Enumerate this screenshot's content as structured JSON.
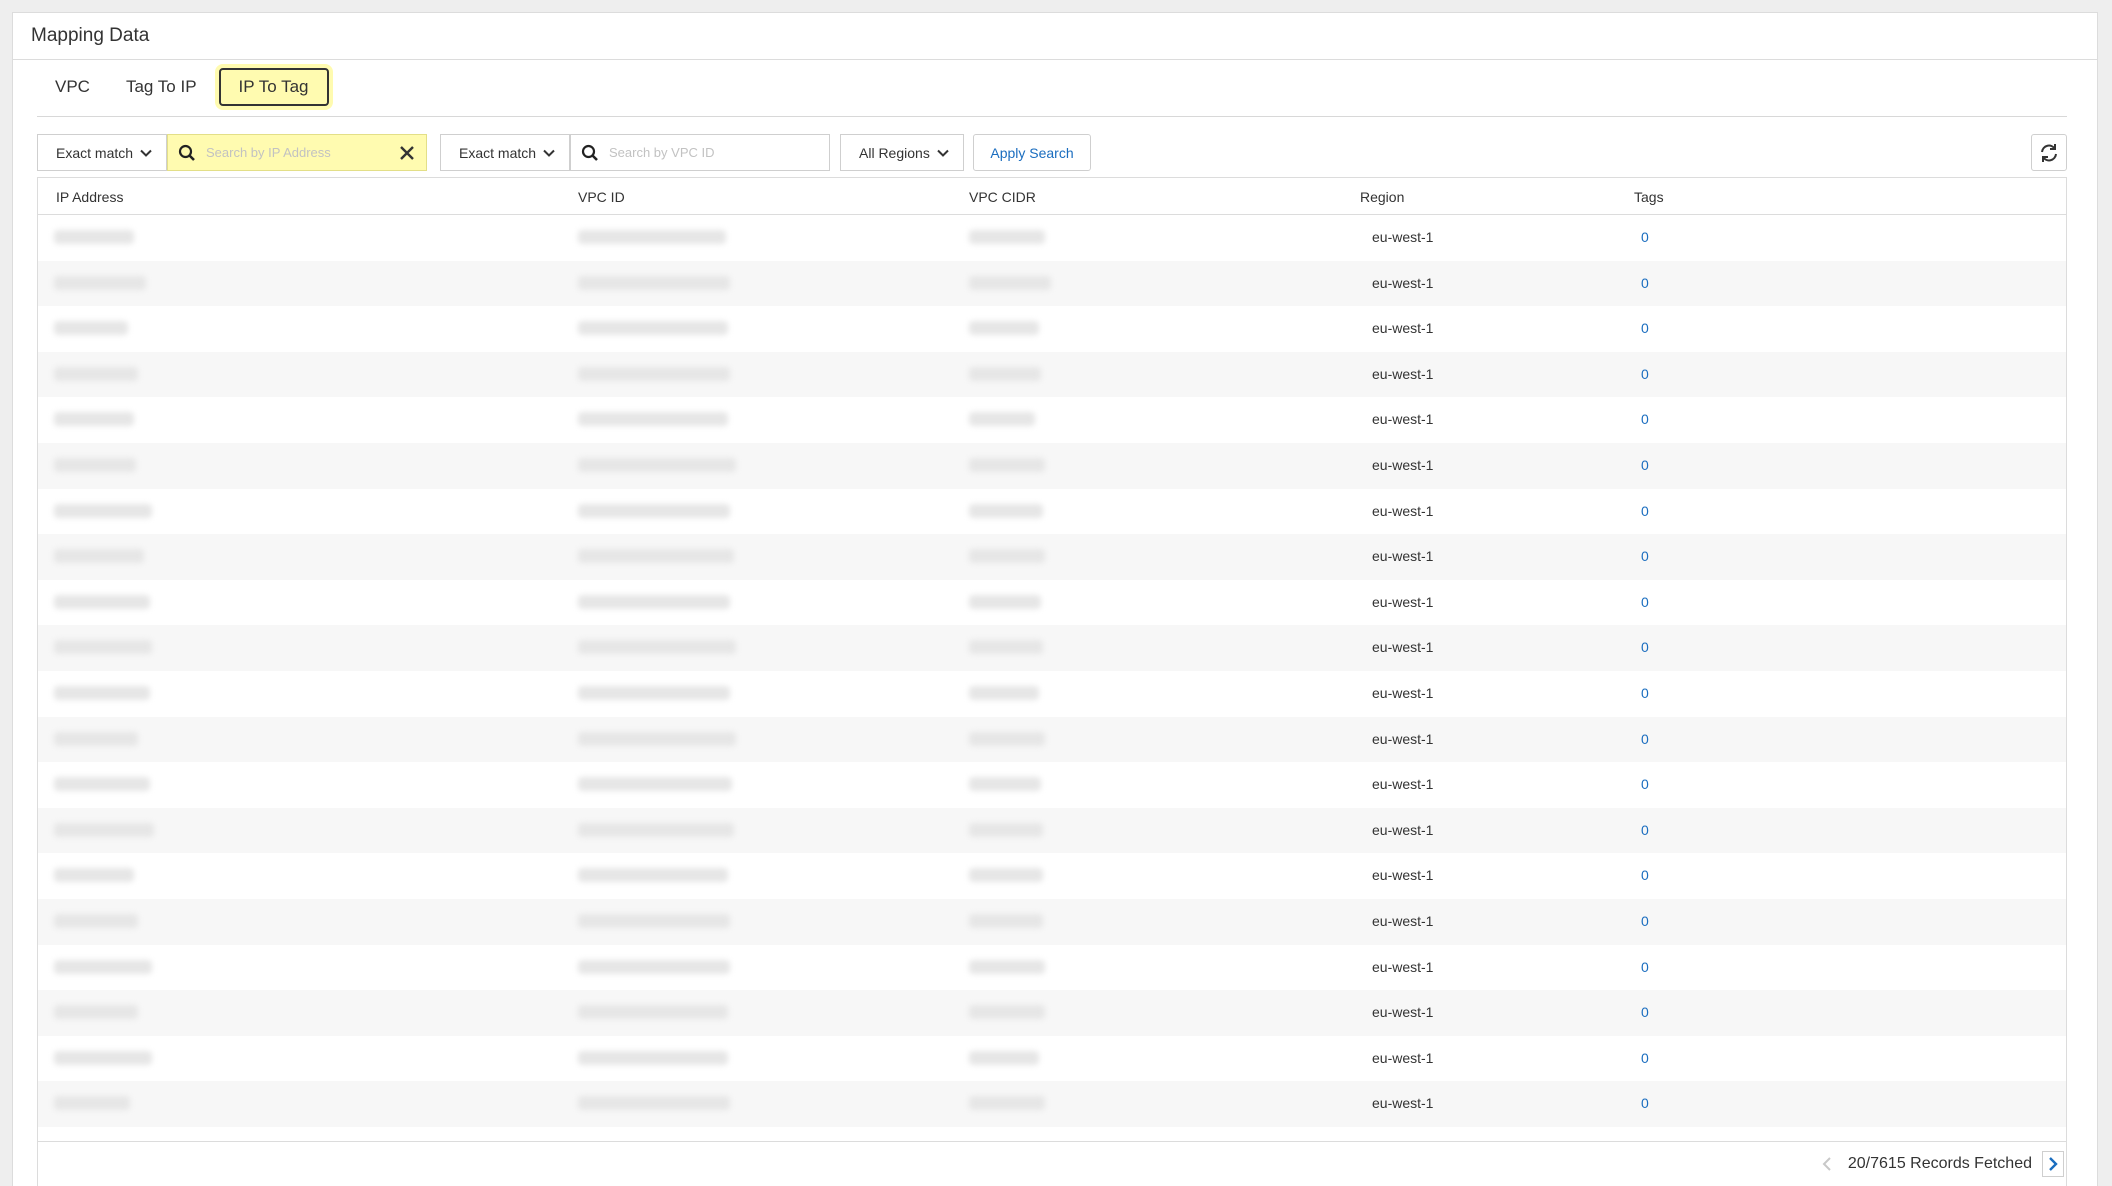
{
  "panel": {
    "title": "Mapping Data"
  },
  "tabs": [
    {
      "label": "VPC"
    },
    {
      "label": "Tag To IP"
    },
    {
      "label": "IP To Tag",
      "active": true
    }
  ],
  "filters": {
    "ip_match": "Exact match",
    "ip_search_placeholder": "Search by IP Address",
    "vpc_match": "Exact match",
    "vpc_search_placeholder": "Search by VPC ID",
    "region": "All Regions",
    "apply_label": "Apply Search"
  },
  "table": {
    "columns": [
      "IP Address",
      "VPC ID",
      "VPC CIDR",
      "Region",
      "Tags"
    ],
    "rows": [
      {
        "region": "eu-west-1",
        "tags": "0"
      },
      {
        "region": "eu-west-1",
        "tags": "0"
      },
      {
        "region": "eu-west-1",
        "tags": "0"
      },
      {
        "region": "eu-west-1",
        "tags": "0"
      },
      {
        "region": "eu-west-1",
        "tags": "0"
      },
      {
        "region": "eu-west-1",
        "tags": "0"
      },
      {
        "region": "eu-west-1",
        "tags": "0"
      },
      {
        "region": "eu-west-1",
        "tags": "0"
      },
      {
        "region": "eu-west-1",
        "tags": "0"
      },
      {
        "region": "eu-west-1",
        "tags": "0"
      },
      {
        "region": "eu-west-1",
        "tags": "0"
      },
      {
        "region": "eu-west-1",
        "tags": "0"
      },
      {
        "region": "eu-west-1",
        "tags": "0"
      },
      {
        "region": "eu-west-1",
        "tags": "0"
      },
      {
        "region": "eu-west-1",
        "tags": "0"
      },
      {
        "region": "eu-west-1",
        "tags": "0"
      },
      {
        "region": "eu-west-1",
        "tags": "0"
      },
      {
        "region": "eu-west-1",
        "tags": "0"
      },
      {
        "region": "eu-west-1",
        "tags": "0"
      },
      {
        "region": "eu-west-1",
        "tags": "0"
      }
    ]
  },
  "footer": {
    "records": "20/7615 Records Fetched"
  },
  "colors": {
    "accent": "#1a6dbf",
    "highlight": "#fffbb0"
  }
}
